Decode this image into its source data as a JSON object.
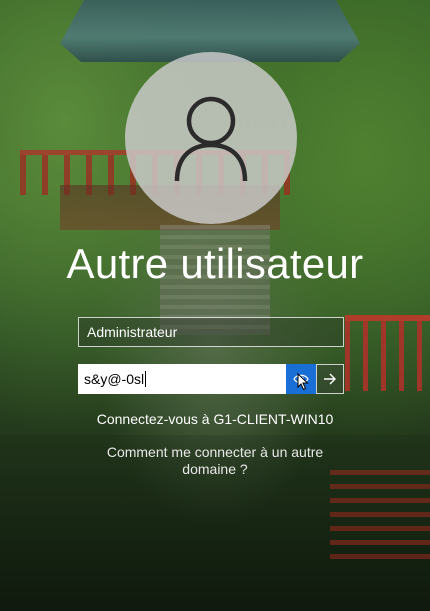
{
  "login": {
    "username_title": "Autre utilisateur",
    "username_field_value": "Administrateur",
    "password_field_value": "s&y@-0sl",
    "connect_to_text": "Connectez-vous à G1-CLIENT-WIN10",
    "other_domain_link": "Comment me connecter à un autre domaine ?"
  },
  "icons": {
    "avatar": "user-silhouette-icon",
    "reveal": "eye-icon",
    "submit": "arrow-right-icon",
    "pointer": "mouse-pointer-icon"
  },
  "colors": {
    "accent": "#1a6fd6",
    "text": "#ffffff"
  }
}
